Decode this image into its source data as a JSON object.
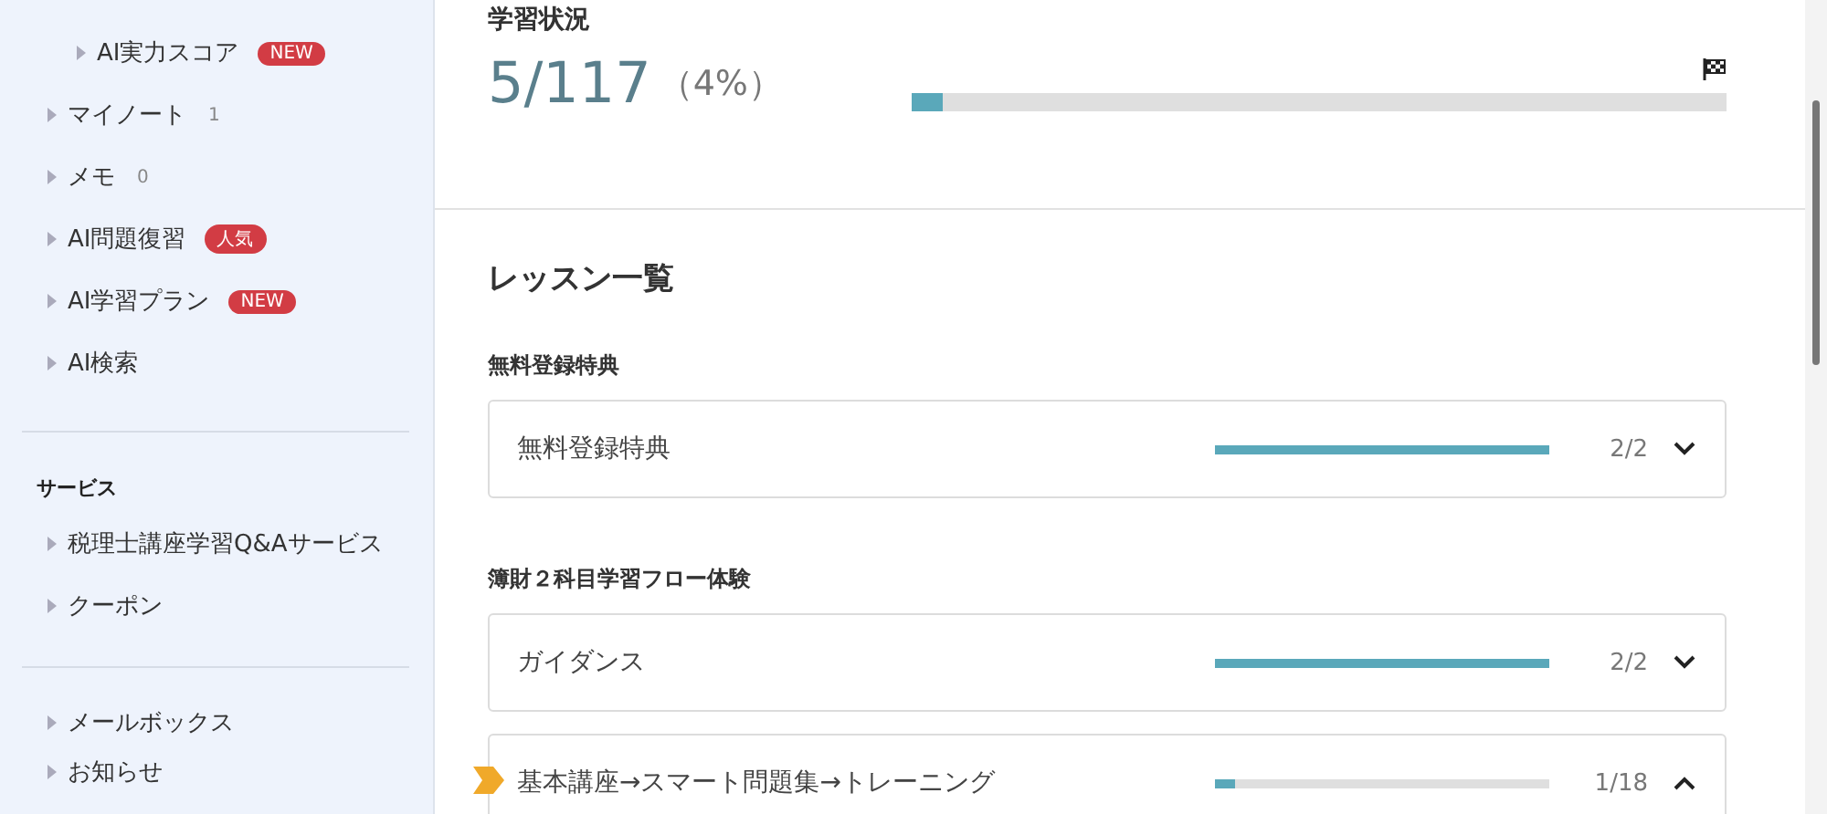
{
  "sidebar": {
    "sections": [
      {
        "items": [
          {
            "children": [
              {
                "label": "AI実力スコア",
                "badge": "NEW"
              }
            ]
          },
          {
            "label": "マイノート",
            "count": "1"
          },
          {
            "label": "メモ",
            "count": "0"
          },
          {
            "label": "AI問題復習",
            "badge": "人気"
          },
          {
            "label": "AI学習プラン",
            "badge": "NEW"
          },
          {
            "label": "AI検索"
          }
        ]
      },
      {
        "title": "サービス",
        "items": [
          {
            "label": "税理士講座学習Q&Aサービス"
          },
          {
            "label": "クーポン"
          }
        ]
      },
      {
        "items": [
          {
            "label": "メールボックス"
          },
          {
            "label": "お知らせ"
          }
        ]
      }
    ]
  },
  "status": {
    "title": "学習状況",
    "done": "5/117",
    "percent": "（4%）",
    "level": 0.04
  },
  "lessons": {
    "title": "レッスン一覧",
    "groups": [
      {
        "title": "無料登録特典",
        "cards": [
          {
            "title": "無料登録特典",
            "level": 1,
            "count": "2/2",
            "expanded": false,
            "current": false
          }
        ]
      },
      {
        "title": "簿財２科目学習フロー体験",
        "cards": [
          {
            "title": "ガイダンス",
            "level": 1,
            "count": "2/2",
            "expanded": false,
            "current": false
          },
          {
            "title": "基本講座→スマート問題集→トレーニング",
            "level": 0.06,
            "count": "1/18",
            "expanded": true,
            "current": true
          }
        ]
      }
    ]
  }
}
